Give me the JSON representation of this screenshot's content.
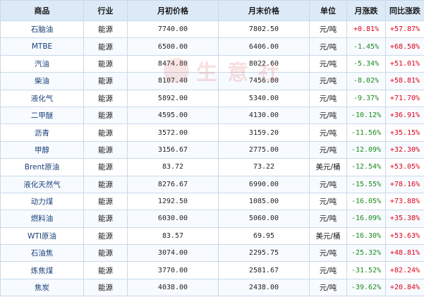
{
  "table": {
    "headers": [
      "商品",
      "行业",
      "月初价格",
      "月末价格",
      "单位",
      "月涨跌",
      "同比涨跌"
    ],
    "rows": [
      {
        "name": "石脑油",
        "industry": "能源",
        "start": "7740.00",
        "end": "7802.50",
        "unit": "元/吨",
        "mom": "+0.81%",
        "yoy": "+57.87%"
      },
      {
        "name": "MTBE",
        "industry": "能源",
        "start": "6500.00",
        "end": "6406.00",
        "unit": "元/吨",
        "mom": "-1.45%",
        "yoy": "+68.58%"
      },
      {
        "name": "汽油",
        "industry": "能源",
        "start": "8474.80",
        "end": "8022.60",
        "unit": "元/吨",
        "mom": "-5.34%",
        "yoy": "+51.01%"
      },
      {
        "name": "柴油",
        "industry": "能源",
        "start": "8107.40",
        "end": "7456.80",
        "unit": "元/吨",
        "mom": "-8.02%",
        "yoy": "+58.81%"
      },
      {
        "name": "液化气",
        "industry": "能源",
        "start": "5892.00",
        "end": "5340.00",
        "unit": "元/吨",
        "mom": "-9.37%",
        "yoy": "+71.70%"
      },
      {
        "name": "二甲醚",
        "industry": "能源",
        "start": "4595.00",
        "end": "4130.00",
        "unit": "元/吨",
        "mom": "-10.12%",
        "yoy": "+36.91%"
      },
      {
        "name": "沥青",
        "industry": "能源",
        "start": "3572.00",
        "end": "3159.20",
        "unit": "元/吨",
        "mom": "-11.56%",
        "yoy": "+35.15%"
      },
      {
        "name": "甲醇",
        "industry": "能源",
        "start": "3156.67",
        "end": "2775.00",
        "unit": "元/吨",
        "mom": "-12.09%",
        "yoy": "+32.30%"
      },
      {
        "name": "Brent原油",
        "industry": "能源",
        "start": "83.72",
        "end": "73.22",
        "unit": "美元/桶",
        "mom": "-12.54%",
        "yoy": "+53.05%"
      },
      {
        "name": "液化天然气",
        "industry": "能源",
        "start": "8276.67",
        "end": "6990.00",
        "unit": "元/吨",
        "mom": "-15.55%",
        "yoy": "+78.16%"
      },
      {
        "name": "动力煤",
        "industry": "能源",
        "start": "1292.50",
        "end": "1085.00",
        "unit": "元/吨",
        "mom": "-16.05%",
        "yoy": "+73.88%"
      },
      {
        "name": "燃料油",
        "industry": "能源",
        "start": "6030.00",
        "end": "5060.00",
        "unit": "元/吨",
        "mom": "-16.09%",
        "yoy": "+35.38%"
      },
      {
        "name": "WTI原油",
        "industry": "能源",
        "start": "83.57",
        "end": "69.95",
        "unit": "美元/桶",
        "mom": "-16.30%",
        "yoy": "+53.63%"
      },
      {
        "name": "石油焦",
        "industry": "能源",
        "start": "3074.00",
        "end": "2295.75",
        "unit": "元/吨",
        "mom": "-25.32%",
        "yoy": "+48.81%"
      },
      {
        "name": "炼焦煤",
        "industry": "能源",
        "start": "3770.00",
        "end": "2581.67",
        "unit": "元/吨",
        "mom": "-31.52%",
        "yoy": "+82.24%"
      },
      {
        "name": "焦炭",
        "industry": "能源",
        "start": "4038.00",
        "end": "2438.00",
        "unit": "元/吨",
        "mom": "-39.62%",
        "yoy": "+20.84%"
      }
    ]
  },
  "watermark": {
    "text": "生意社"
  },
  "colors": {
    "header_bg": "#dce9f7",
    "border": "#c9d9ea",
    "positive": "#e0001a",
    "negative": "#1a8a1a",
    "name_text": "#1a3f7a"
  }
}
